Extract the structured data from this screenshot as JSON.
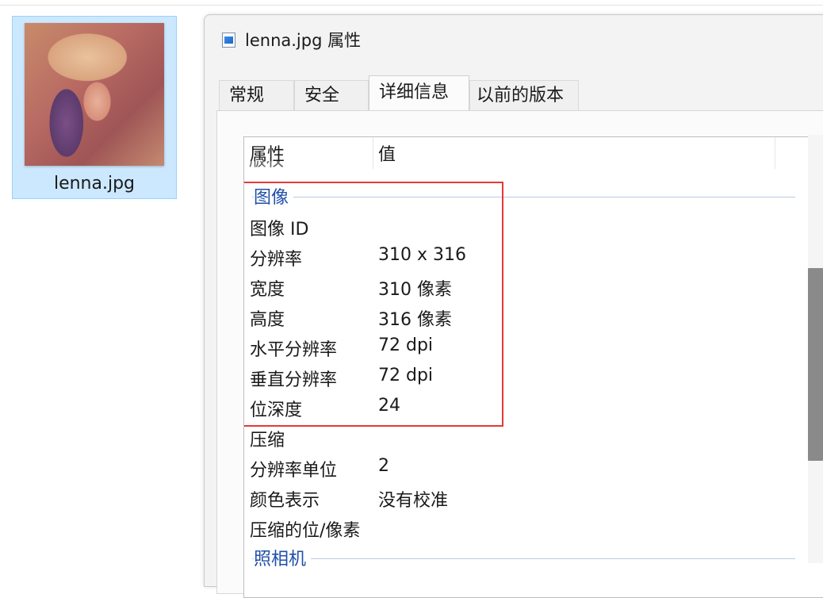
{
  "desktop": {
    "file_name": "lenna.jpg"
  },
  "dialog": {
    "title": "lenna.jpg 属性",
    "tabs": [
      {
        "label": "常规"
      },
      {
        "label": "安全"
      },
      {
        "label": "详细信息",
        "active": true
      },
      {
        "label": "以前的版本"
      }
    ],
    "list": {
      "columns": [
        "属性",
        "值"
      ],
      "partial_row": "版权",
      "group_image": "图像",
      "rows": [
        {
          "name": "图像 ID",
          "value": ""
        },
        {
          "name": "分辨率",
          "value": "310 x 316"
        },
        {
          "name": "宽度",
          "value": "310 像素"
        },
        {
          "name": "高度",
          "value": "316 像素"
        },
        {
          "name": "水平分辨率",
          "value": "72 dpi"
        },
        {
          "name": "垂直分辨率",
          "value": "72 dpi"
        },
        {
          "name": "位深度",
          "value": "24"
        },
        {
          "name": "压缩",
          "value": ""
        },
        {
          "name": "分辨率单位",
          "value": "2"
        },
        {
          "name": "颜色表示",
          "value": "没有校准"
        },
        {
          "name": "压缩的位/像素",
          "value": ""
        }
      ],
      "group_camera": "照相机"
    }
  },
  "colors": {
    "selection_bg": "#cce8ff",
    "group_text": "#1f4fa8",
    "highlight_box": "#e53935"
  }
}
